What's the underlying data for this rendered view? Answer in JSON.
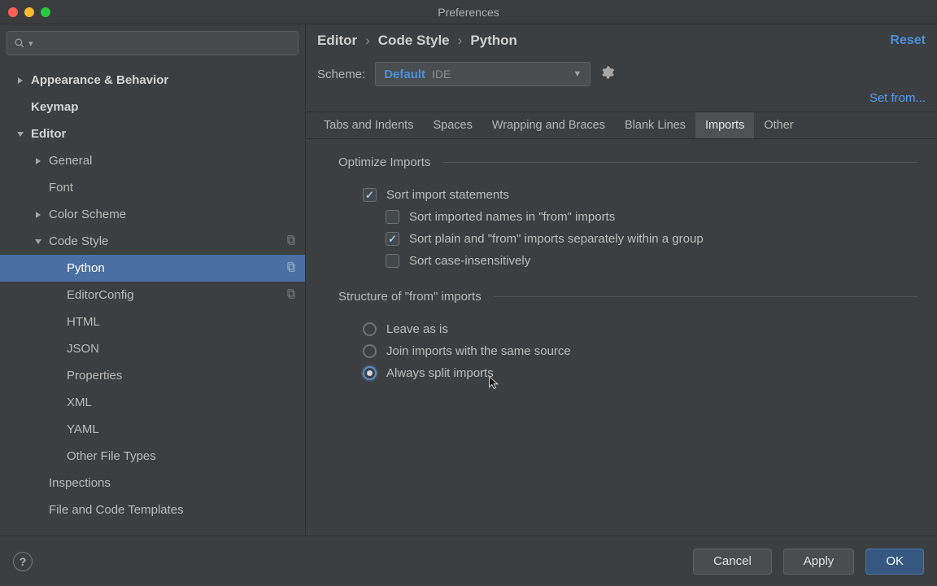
{
  "window": {
    "title": "Preferences"
  },
  "breadcrumbs": {
    "a": "Editor",
    "b": "Code Style",
    "c": "Python",
    "reset": "Reset"
  },
  "scheme": {
    "label": "Scheme:",
    "name": "Default",
    "scope": "IDE"
  },
  "set_from": "Set from...",
  "tabs": {
    "t0": "Tabs and Indents",
    "t1": "Spaces",
    "t2": "Wrapping and Braces",
    "t3": "Blank Lines",
    "t4": "Imports",
    "t5": "Other",
    "active": "t4"
  },
  "sections": {
    "optimize": {
      "title": "Optimize Imports",
      "sort_statements": {
        "label": "Sort import statements",
        "checked": true
      },
      "sort_names": {
        "label": "Sort imported names in \"from\" imports",
        "checked": false
      },
      "sort_separately": {
        "label": "Sort plain and \"from\" imports separately within a group",
        "checked": true
      },
      "sort_case": {
        "label": "Sort case-insensitively",
        "checked": false
      }
    },
    "structure": {
      "title": "Structure of \"from\" imports",
      "leave": {
        "label": "Leave as is"
      },
      "join": {
        "label": "Join imports with the same source"
      },
      "split": {
        "label": "Always split imports"
      },
      "selected": "split"
    }
  },
  "tree": {
    "appearance": "Appearance & Behavior",
    "keymap": "Keymap",
    "editor": "Editor",
    "general": "General",
    "font": "Font",
    "color_scheme": "Color Scheme",
    "code_style": "Code Style",
    "python": "Python",
    "editorconfig": "EditorConfig",
    "html": "HTML",
    "json": "JSON",
    "properties": "Properties",
    "xml": "XML",
    "yaml": "YAML",
    "other_file_types": "Other File Types",
    "inspections": "Inspections",
    "file_code_templates": "File and Code Templates"
  },
  "buttons": {
    "cancel": "Cancel",
    "apply": "Apply",
    "ok": "OK"
  }
}
